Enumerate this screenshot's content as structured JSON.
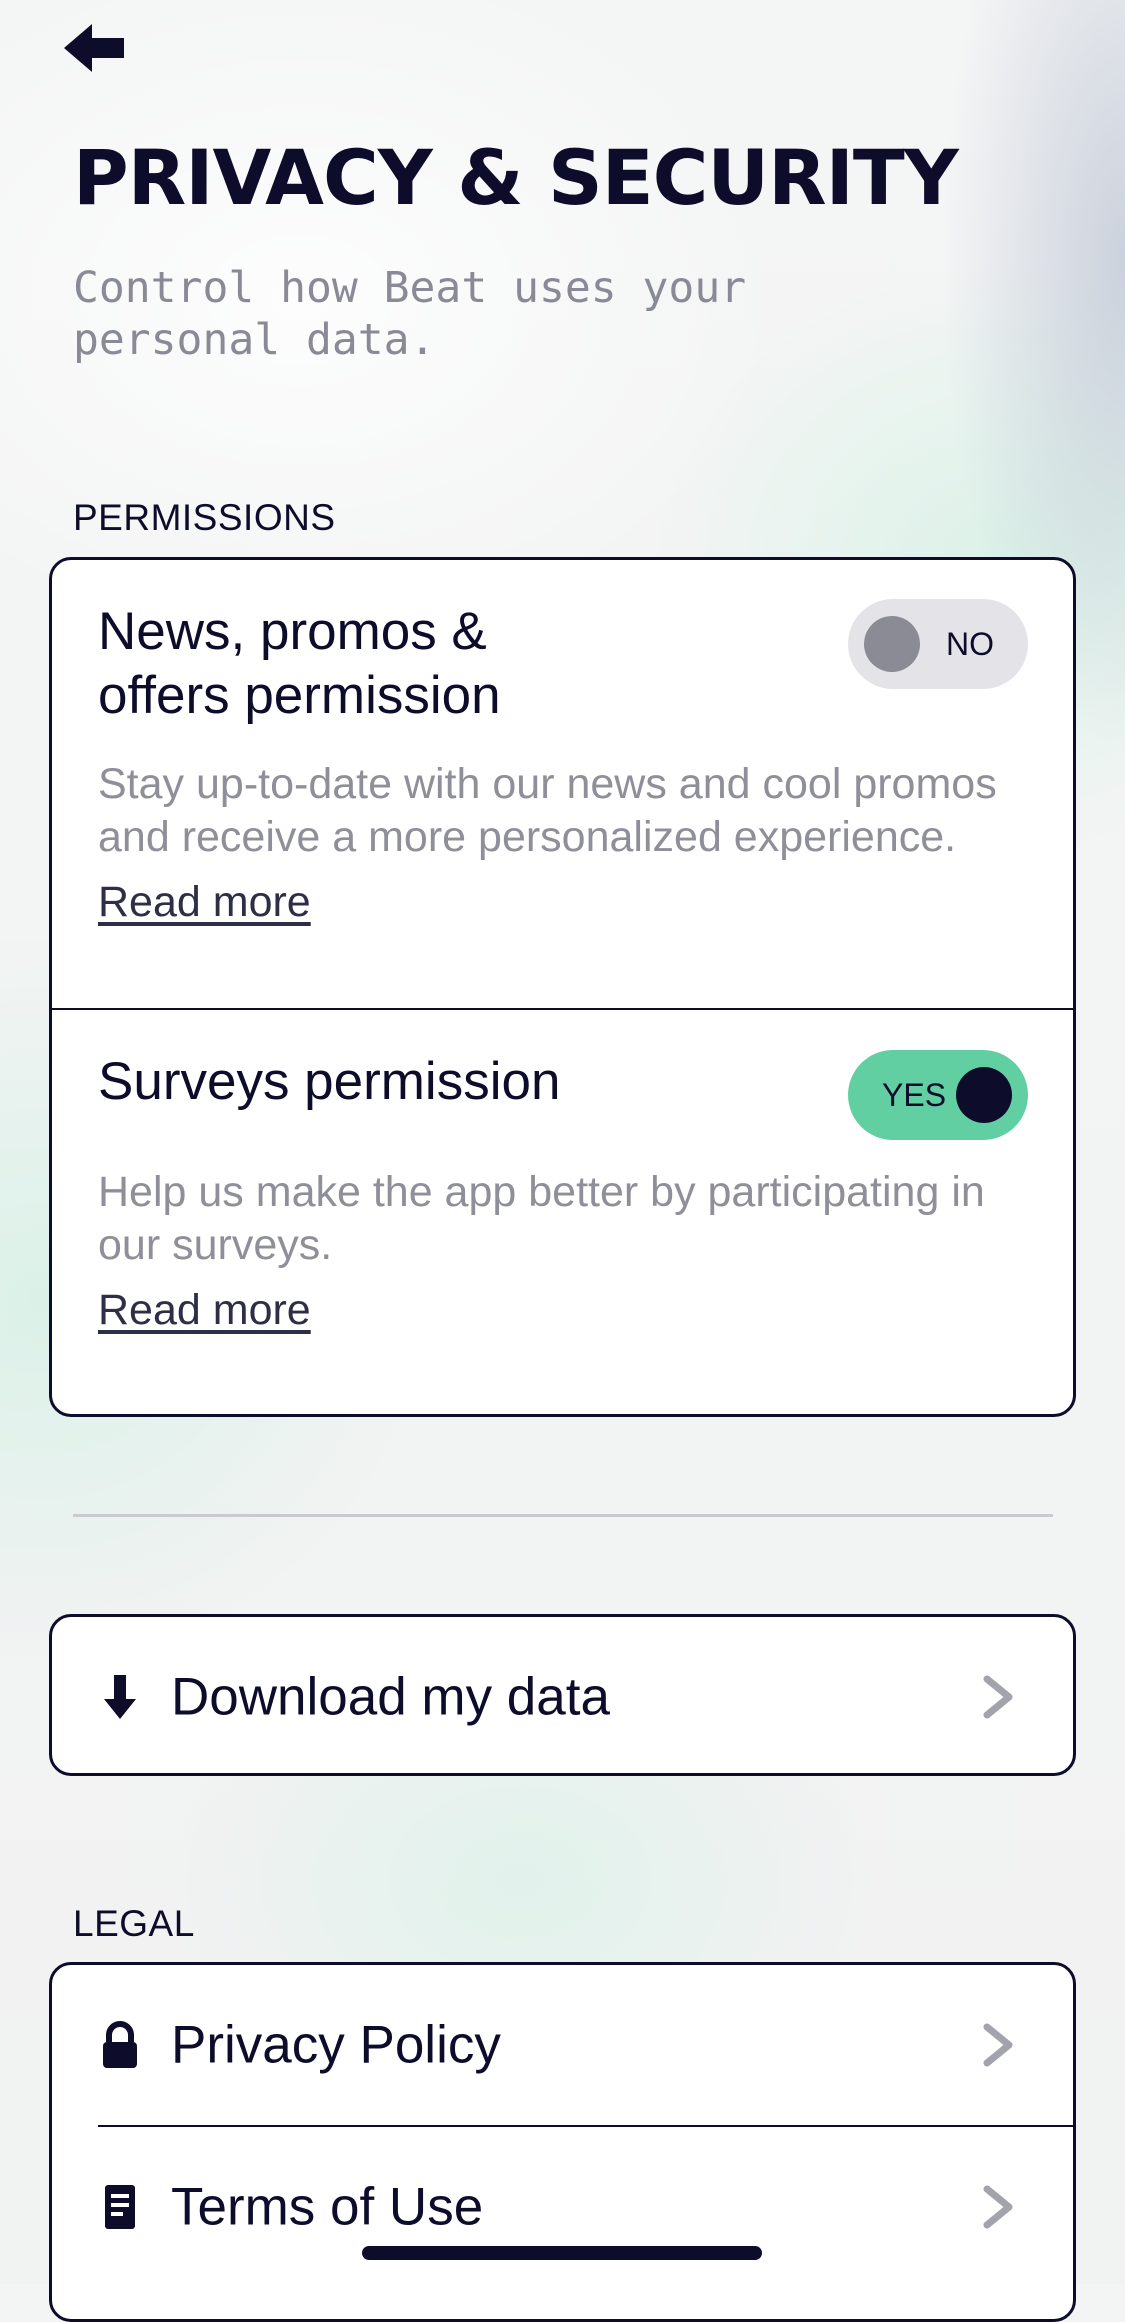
{
  "header": {
    "back_icon": "arrow-left-icon",
    "title": "PRIVACY & SECURITY",
    "subtitle": "Control how Beat uses your personal data."
  },
  "permissions": {
    "section_label": "PERMISSIONS",
    "items": [
      {
        "title": "News, promos & offers permission",
        "description": "Stay up-to-date with our news and cool promos and receive a more personalized experience.",
        "read_more": "Read more",
        "toggle_label": "NO",
        "enabled": false
      },
      {
        "title": "Surveys permission",
        "description": "Help us make the app better by participating in our surveys.",
        "read_more": "Read more",
        "toggle_label": "YES",
        "enabled": true
      }
    ]
  },
  "download": {
    "icon": "download-arrow-icon",
    "label": "Download my data",
    "chevron_icon": "chevron-right-icon"
  },
  "legal": {
    "section_label": "LEGAL",
    "items": [
      {
        "icon": "lock-icon",
        "label": "Privacy Policy",
        "chevron_icon": "chevron-right-icon"
      },
      {
        "icon": "document-icon",
        "label": "Terms of Use",
        "chevron_icon": "chevron-right-icon"
      }
    ]
  },
  "colors": {
    "ink": "#0d0d2b",
    "toggle_on": "#62cfa3",
    "toggle_off": "#e4e4e8",
    "muted_text": "#8f8f99"
  }
}
